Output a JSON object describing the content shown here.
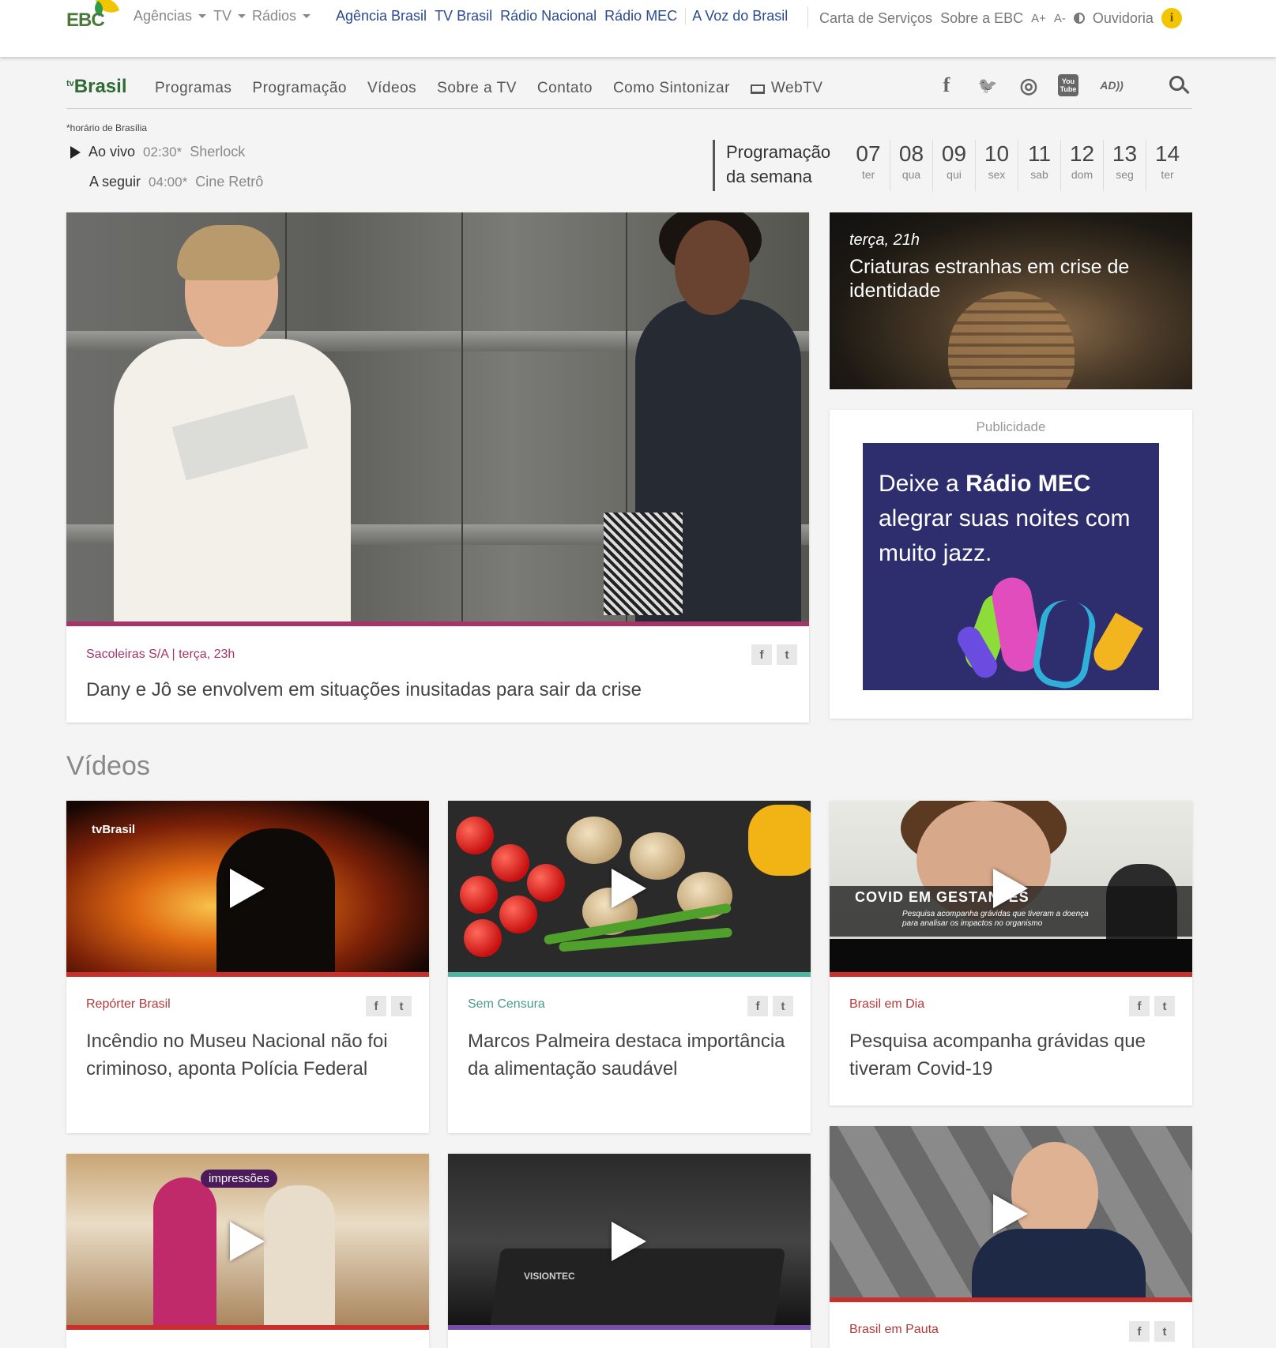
{
  "ebc_bar": {
    "logo": "EBC",
    "menus": [
      {
        "label": "Agências"
      },
      {
        "label": "TV"
      },
      {
        "label": "Rádios"
      }
    ],
    "brands": [
      "Agência Brasil",
      "TV Brasil",
      "Rádio Nacional",
      "Rádio MEC",
      "A Voz do Brasil"
    ],
    "right_links": {
      "services": "Carta de Serviços",
      "about": "Sobre a EBC",
      "font_up": "A+",
      "font_down": "A-",
      "ombudsman": "Ouvidoria",
      "info_glyph": "i"
    }
  },
  "tv_nav": {
    "logo_small": "tv",
    "logo": "Brasil",
    "items": [
      "Programas",
      "Programação",
      "Vídeos",
      "Sobre a TV",
      "Contato",
      "Como Sintonizar",
      "WebTV"
    ],
    "social": [
      {
        "name": "facebook-icon",
        "glyph": "f"
      },
      {
        "name": "twitter-icon",
        "glyph": "🐦"
      },
      {
        "name": "instagram-icon",
        "glyph": "◎"
      },
      {
        "name": "youtube-icon",
        "glyph": "You Tube"
      },
      {
        "name": "audio-description-icon",
        "glyph": "AD))"
      }
    ],
    "search_icon": "search-icon"
  },
  "schedule": {
    "timezone_note": "*horário de Brasília",
    "live": {
      "label": "Ao vivo",
      "time": "02:30*",
      "program": "Sherlock"
    },
    "next": {
      "label": "A seguir",
      "time": "04:00*",
      "program": "Cine Retrô"
    },
    "week_title_1": "Programação",
    "week_title_2": "da semana",
    "days": [
      {
        "n": "07",
        "d": "ter"
      },
      {
        "n": "08",
        "d": "qua"
      },
      {
        "n": "09",
        "d": "qui"
      },
      {
        "n": "10",
        "d": "sex"
      },
      {
        "n": "11",
        "d": "sab"
      },
      {
        "n": "12",
        "d": "dom"
      },
      {
        "n": "13",
        "d": "seg"
      },
      {
        "n": "14",
        "d": "ter"
      }
    ]
  },
  "hero": {
    "meta": "Sacoleiras S/A | terça, 23h",
    "title": "Dany e Jô se envolvem em situações inusitadas para sair da crise",
    "bar_color": "#a6336a",
    "meta_color": "#a6336a"
  },
  "promo": {
    "kicker": "terça, 21h",
    "title": "Criaturas estranhas em crise de identidade"
  },
  "ad": {
    "label": "Publicidade",
    "line1a": "Deixe a ",
    "line1b": "Rádio MEC",
    "line2": "alegrar suas noites com",
    "line3": "muito jazz."
  },
  "videos": {
    "heading": "Vídeos",
    "items": [
      {
        "meta": "Repórter Brasil",
        "title": "Incêndio no Museu Nacional não foi criminoso, aponta Polícia Federal",
        "bar": "#c9302c",
        "meta_color": "#b23a3a",
        "thumb_logo": "tvBrasil"
      },
      {
        "meta": "Sem Censura",
        "title": "Marcos Palmeira destaca importância da alimentação saudável",
        "bar": "#4fb5a0",
        "meta_color": "#4a9a8a"
      },
      {
        "meta": "Brasil em Dia",
        "title": "Pesquisa acompanha grávidas que tiveram Covid-19",
        "bar": "#c9302c",
        "meta_color": "#b23a3a",
        "caption": "COVID EM GESTANTES",
        "sub1": "Pesquisa acompanha grávidas que tiveram a doença",
        "sub2": "para analisar os impactos no organismo"
      },
      {
        "meta": "",
        "title": "",
        "bar": "#c9302c",
        "bubble": "impressões"
      },
      {
        "meta": "",
        "title": "",
        "bar": "#7a4ea8",
        "brand": "VISIONTEC"
      },
      {
        "meta": "Brasil em Pauta",
        "title": "",
        "bar": "#c9302c",
        "meta_color": "#b23a3a"
      }
    ]
  }
}
